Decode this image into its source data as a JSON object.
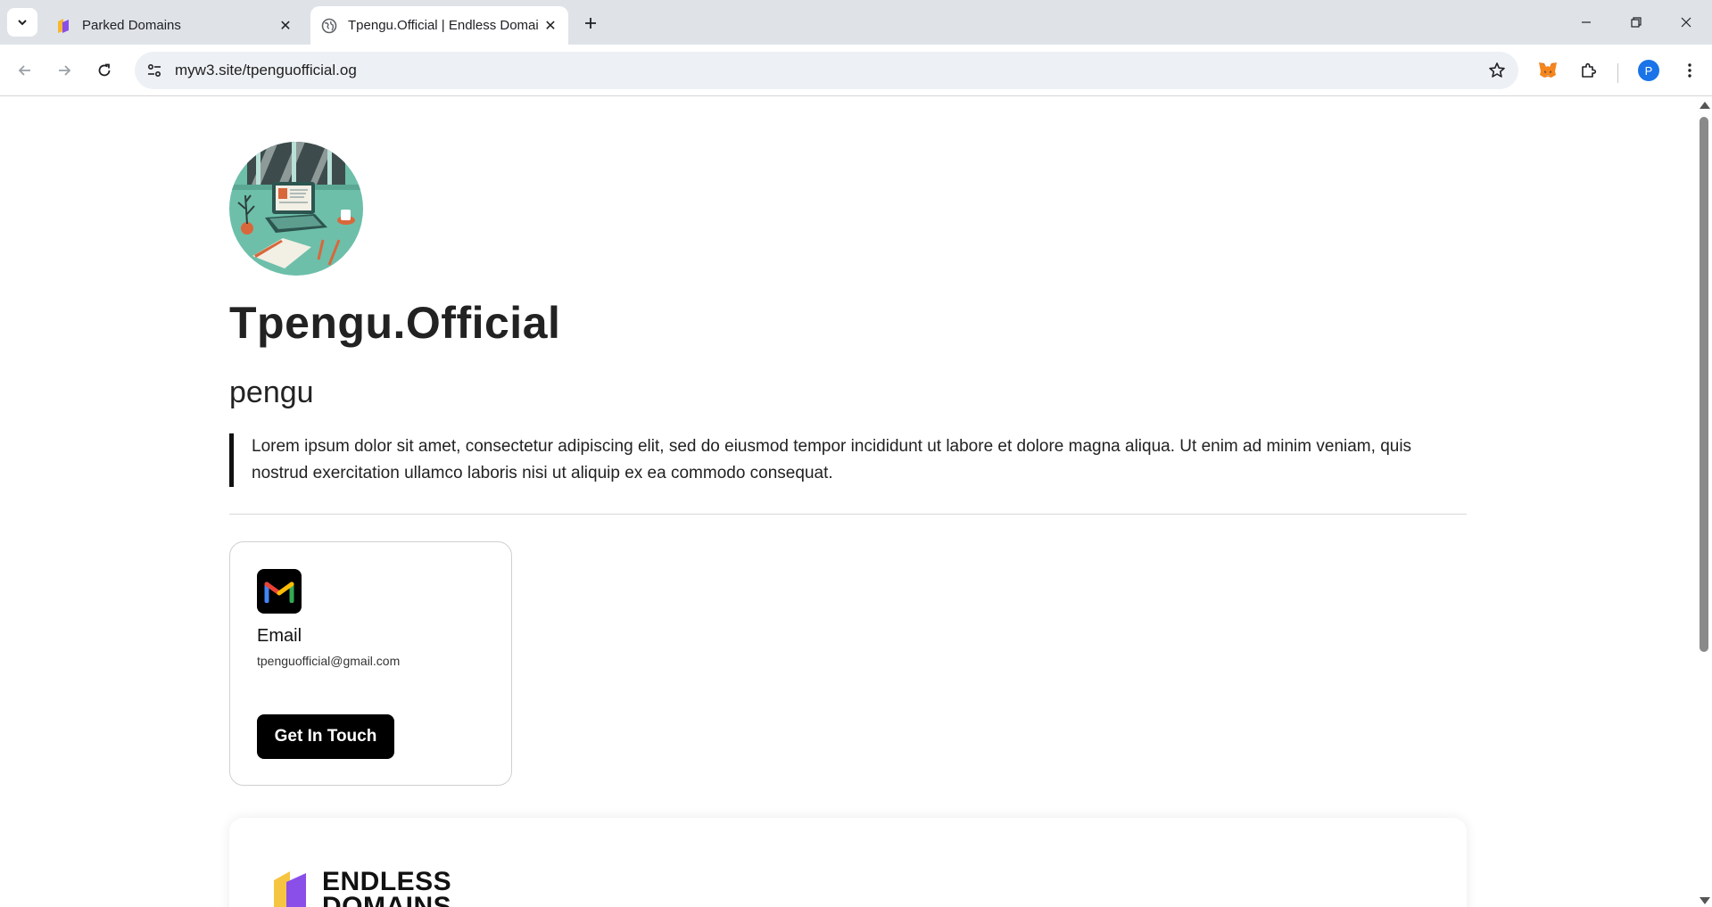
{
  "browser": {
    "tabs": [
      {
        "title": "Parked Domains",
        "active": false
      },
      {
        "title": "Tpengu.Official | Endless Domai",
        "active": true
      }
    ],
    "url": "myw3.site/tpenguofficial.og",
    "profile_initial": "P"
  },
  "page": {
    "title": "Tpengu.Official",
    "subtitle": "pengu",
    "description": "Lorem ipsum dolor sit amet, consectetur adipiscing elit, sed do eiusmod tempor incididunt ut labore et dolore magna aliqua. Ut enim ad minim veniam, quis nostrud exercitation ullamco laboris nisi ut aliquip ex ea commodo consequat.",
    "contact_card": {
      "label": "Email",
      "value": "tpenguofficial@gmail.com",
      "button": "Get In Touch"
    },
    "footer_logo": {
      "line1": "ENDLESS",
      "line2": "DOMAINS"
    }
  },
  "colors": {
    "accent": "#000000",
    "tabstrip": "#dfe3e8",
    "omnibox": "#edf0f4",
    "avatar_bg": "#6dbfa9"
  }
}
